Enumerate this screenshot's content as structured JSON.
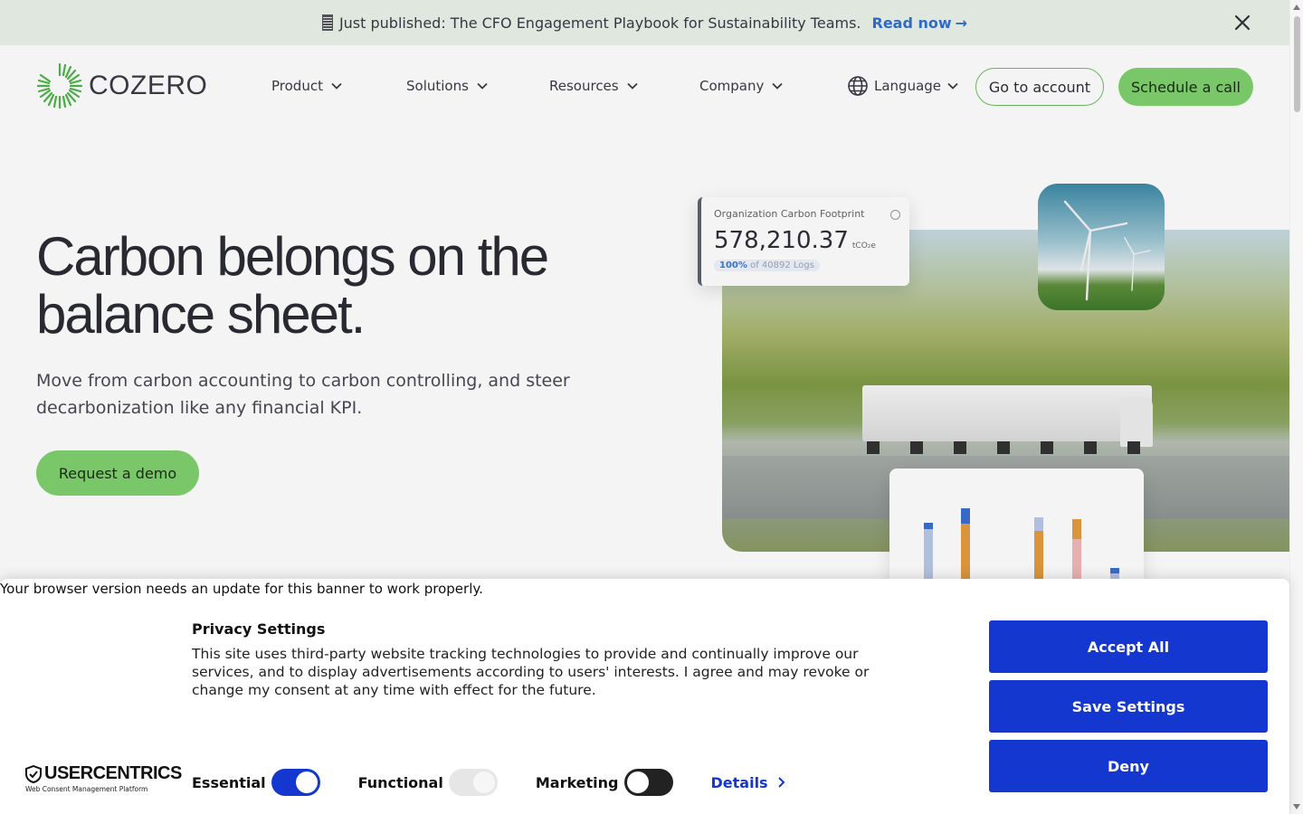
{
  "announcement": {
    "text": "Just published: The CFO Engagement Playbook for Sustainability Teams.",
    "link": "Read now",
    "arrow": "→"
  },
  "nav": {
    "brand": "COZERO",
    "items": [
      {
        "label": "Product"
      },
      {
        "label": "Solutions"
      },
      {
        "label": "Resources"
      },
      {
        "label": "Company"
      }
    ],
    "language": "Language",
    "account_button": "Go to account",
    "call_button": "Schedule a call"
  },
  "hero": {
    "title": "Carbon belongs on the balance sheet.",
    "subtitle": "Move from carbon accounting to carbon controlling, and steer decarbonization like any financial KPI.",
    "cta": "Request a demo"
  },
  "stat_card": {
    "label": "Organization Carbon Footprint",
    "value": "578,210.37",
    "unit": "tCO₂e",
    "percent": "100%",
    "logs": "of 40892 Logs"
  },
  "consent": {
    "browser_warning": "Your browser version needs an update for this banner to work properly.",
    "title": "Privacy Settings",
    "description": "This site uses third-party website tracking technologies to provide and continually improve our services, and to display advertisements according to users' interests. I agree and may revoke or change my consent at any time with effect for the future.",
    "brand": "USERCENTRICS",
    "brand_sub": "Web Consent Management Platform",
    "toggles": [
      {
        "label": "Essential",
        "state": "on-locked"
      },
      {
        "label": "Functional",
        "state": "disabled"
      },
      {
        "label": "Marketing",
        "state": "off"
      }
    ],
    "details_link": "Details",
    "buttons": {
      "accept": "Accept All",
      "save": "Save Settings",
      "deny": "Deny"
    }
  },
  "colors": {
    "brand_green": "#7fd06d",
    "consent_blue": "#1437cf",
    "link_blue": "#2f6fd6",
    "announce_bg": "#eaf2e9"
  }
}
